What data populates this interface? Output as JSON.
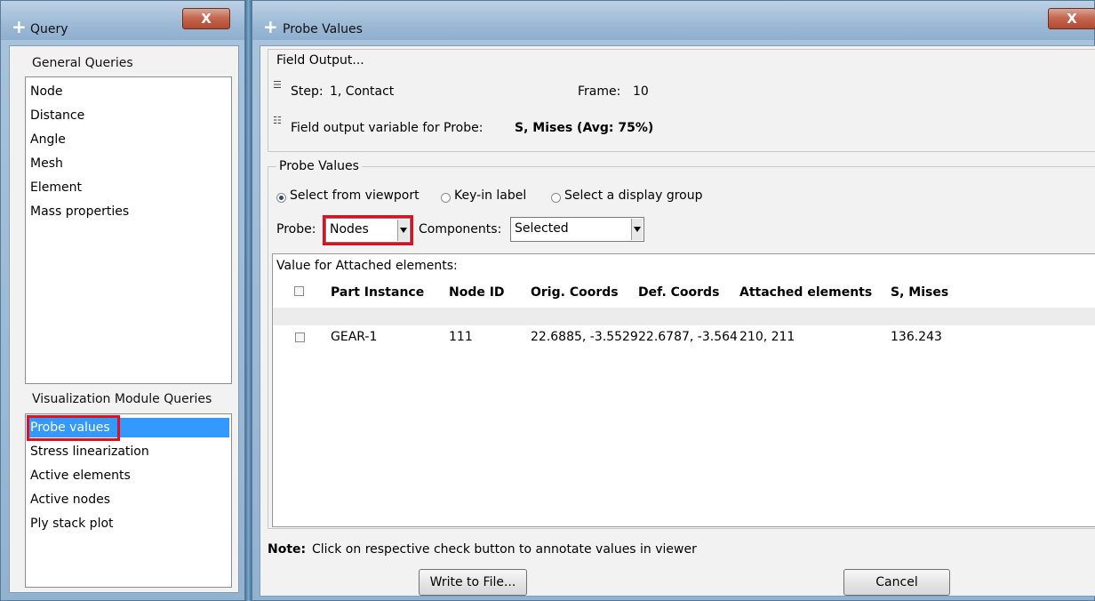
{
  "query_window": {
    "title": "Query",
    "close_label": "X",
    "general_queries": {
      "label": "General Queries",
      "items": [
        "Node",
        "Distance",
        "Angle",
        "Mesh",
        "Element",
        "Mass properties"
      ]
    },
    "visualization_queries": {
      "label": "Visualization Module Queries",
      "items": [
        "Probe values",
        "Stress linearization",
        "Active elements",
        "Active nodes",
        "Ply stack plot"
      ],
      "selected": "Probe values"
    }
  },
  "probe_window": {
    "title": "Probe Values",
    "close_label": "X",
    "field_output": {
      "label": "Field Output...",
      "step_label": "Step:",
      "step_value": "1, Contact",
      "frame_label": "Frame:",
      "frame_value": "10",
      "variable_label": "Field output variable for Probe:",
      "variable_value": "S, Mises (Avg: 75%)"
    },
    "probe_values": {
      "label": "Probe Values",
      "radio_options": [
        "Select from viewport",
        "Key-in label",
        "Select a display group"
      ],
      "radio_selected": "Select from viewport",
      "probe_label": "Probe:",
      "probe_value": "Nodes",
      "components_label": "Components:",
      "components_value": "Selected"
    },
    "table": {
      "caption": "Value for Attached elements:",
      "columns": [
        "Part Instance",
        "Node ID",
        "Orig. Coords",
        "Def. Coords",
        "Attached elements",
        "S, Mises"
      ],
      "rows": [
        {
          "part_instance": "GEAR-1",
          "node_id": "111",
          "orig_coords": "22.6885, -3.5529",
          "def_coords": "22.6787, -3.564",
          "attached_elements": "210, 211",
          "s_mises": "136.243"
        }
      ]
    },
    "note_label": "Note:",
    "note_text": "Click on respective check button to annotate values in viewer",
    "write_button": "Write to File...",
    "cancel_button": "Cancel"
  },
  "colors": {
    "selection": "#3399ff",
    "highlight_box": "#e01020",
    "close_button": "#c66850"
  }
}
